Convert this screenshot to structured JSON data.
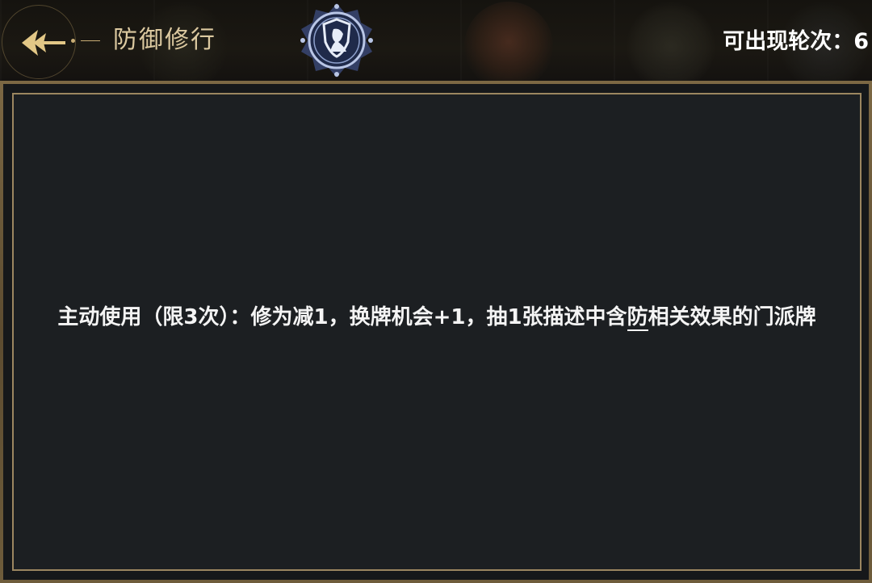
{
  "header": {
    "title": "防御修行",
    "rounds_label": "可出现轮次：",
    "rounds_value": "6"
  },
  "icons": {
    "back": "back-arrow-icon",
    "emblem": "shield-emblem-icon"
  },
  "panel": {
    "description_before": "主动使用（限3次）：修为减1，换牌机会+1，抽1张描述中含",
    "keyword": "防",
    "description_after": "相关效果的门派牌"
  },
  "colors": {
    "title": "#dcc9a0",
    "frame": "#9b8660",
    "panel_bg": "#1c1f22",
    "text": "#f4f4f4"
  }
}
